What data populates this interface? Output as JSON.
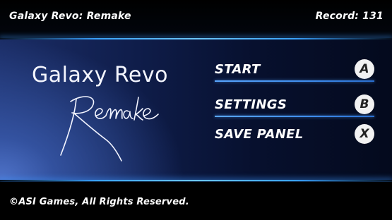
{
  "header": {
    "title": "Galaxy Revo: Remake",
    "record": "Record: 131"
  },
  "logo": {
    "title": "Galaxy Revo",
    "subtitle": "Remake"
  },
  "menu": {
    "items": [
      {
        "label": "START",
        "button": "A"
      },
      {
        "label": "SETTINGS",
        "button": "B"
      },
      {
        "label": "SAVE PANEL",
        "button": "X"
      }
    ]
  },
  "footer": {
    "copyright": "©ASI Games, All Rights Reserved."
  },
  "colors": {
    "accent": "#3aa3ff",
    "panel": "#0f1d4a",
    "background": "#000000"
  }
}
